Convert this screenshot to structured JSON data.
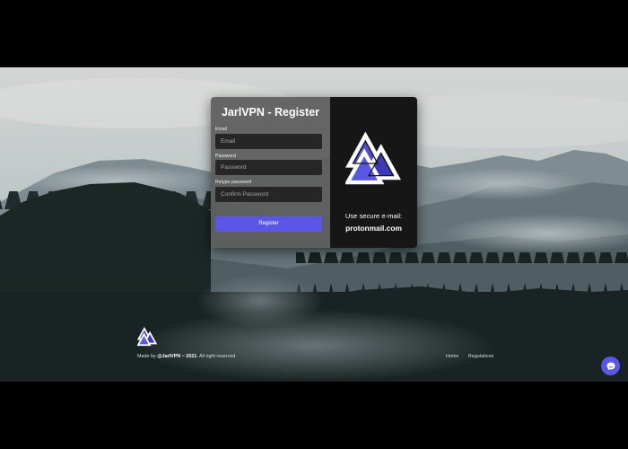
{
  "colors": {
    "accent": "#5a57e6",
    "panel_dark": "#161616",
    "panel_gray": "#5c5c5c",
    "input_bg": "#262626"
  },
  "form": {
    "title": "JarlVPN - Register",
    "email": {
      "label": "Email",
      "placeholder": "Email",
      "value": ""
    },
    "password": {
      "label": "Password",
      "placeholder": "Password",
      "value": ""
    },
    "retype": {
      "label": "Retype password",
      "placeholder": "Confirm Password",
      "value": ""
    },
    "submit_label": "Register"
  },
  "promo": {
    "logo_icon": "valknut-logo-icon",
    "line1": "Use secure e-mail:",
    "line2": "protonmail.com"
  },
  "footer": {
    "logo_icon": "valknut-logo-icon",
    "made_by": "Made by",
    "author": "@JarlVPN",
    "year_text": "~ 2021",
    "rights": ". All right reserved",
    "links": [
      "Home",
      "Regulations"
    ]
  },
  "chat": {
    "icon": "chat-bubble-icon"
  }
}
